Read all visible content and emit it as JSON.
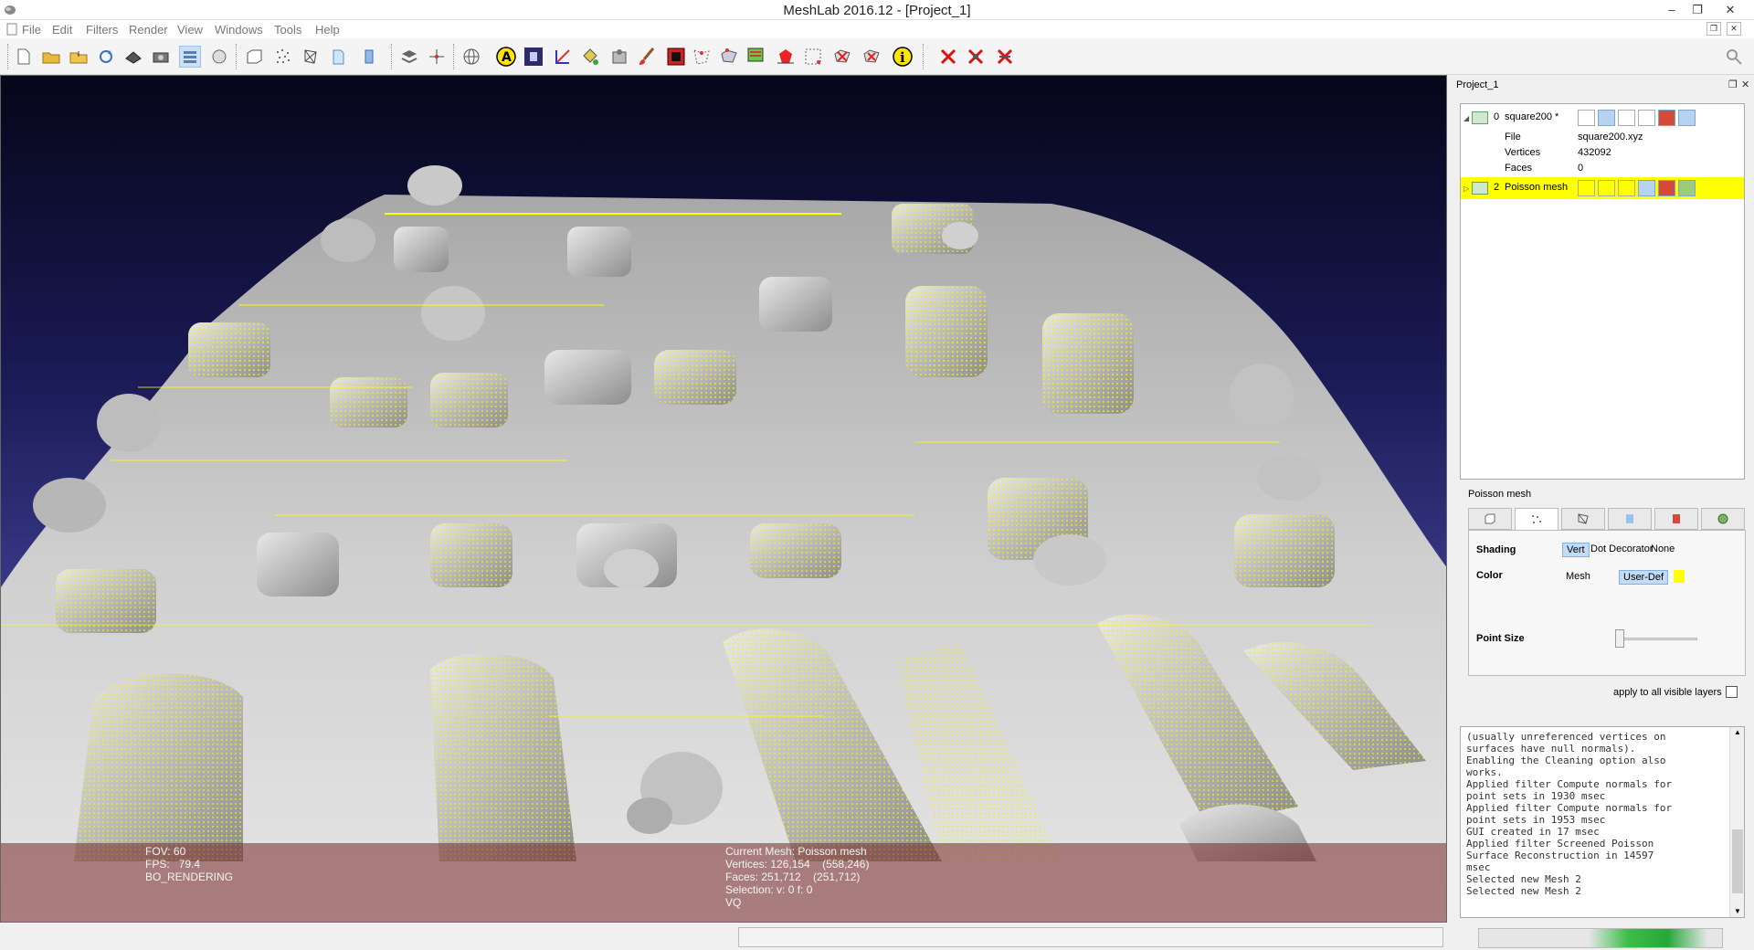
{
  "window": {
    "title": "MeshLab 2016.12 - [Project_1]",
    "minimize_glyph": "–",
    "maximize_glyph": "❐",
    "close_glyph": "✕",
    "mdi_restore_glyph": "❐",
    "mdi_close_glyph": "✕"
  },
  "menu": {
    "file": "File",
    "edit": "Edit",
    "filters": "Filters",
    "render": "Render",
    "view": "View",
    "windows": "Windows",
    "tools": "Tools",
    "help": "Help"
  },
  "panel": {
    "title": "Project_1",
    "float_glyph": "❐",
    "close_glyph": "✕"
  },
  "layers": [
    {
      "id": "0",
      "name": "square200 *",
      "file_label": "File",
      "file_value": "square200.xyz",
      "vertices_label": "Vertices",
      "vertices_value": "432092",
      "faces_label": "Faces",
      "faces_value": "0",
      "selected": false
    },
    {
      "id": "2",
      "name": "Poisson mesh",
      "selected": true
    }
  ],
  "render_panel": {
    "title": "Poisson mesh",
    "shading_label": "Shading",
    "shading_options": [
      "Vert",
      "Dot Decorator",
      "None"
    ],
    "shading_selected": "Vert",
    "color_label": "Color",
    "color_options": [
      "Mesh",
      "User-Def"
    ],
    "color_selected": "User-Def",
    "user_color": "#ffff00",
    "point_size_label": "Point Size",
    "point_size_level": 0.0,
    "apply_all_label": "apply to all visible layers",
    "apply_all_checked": false
  },
  "viewport_info": {
    "fov": "FOV: 60",
    "fps": "FPS:   79.4",
    "render_mode": "BO_RENDERING",
    "current_mesh": "Current Mesh: Poisson mesh",
    "vertices": "Vertices: 126,154    (558,246)",
    "faces": "Faces: 251,712    (251,712)",
    "selection": "Selection: v: 0 f: 0",
    "vq": "VQ"
  },
  "log": [
    "(usually unreferenced vertices on",
    "surfaces have null normals).",
    "Enabling the Cleaning option also",
    "works.",
    "Applied filter Compute normals for",
    "point sets in 1930 msec",
    "Applied filter Compute normals for",
    "point sets in 1953 msec",
    "GUI created in 17 msec",
    "Applied filter Screened Poisson",
    "Surface Reconstruction in 14597",
    "msec",
    "Selected new Mesh 2",
    "Selected new Mesh 2"
  ],
  "colors": {
    "point_cloud": "#ffff00",
    "mesh_surface": "#bdbdbd",
    "selection_highlight": "#ffff00",
    "background_top": "#06061a",
    "background_bottom": "#4d4d9c",
    "progress_green": "#2db240"
  }
}
